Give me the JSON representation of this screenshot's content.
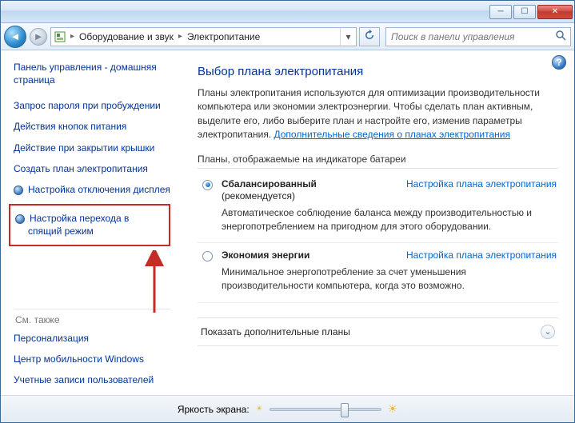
{
  "titlebar": {
    "min": "▁",
    "max": "▢",
    "close": "✕"
  },
  "nav": {
    "addr_seg1": "Оборудование и звук",
    "addr_seg2": "Электропитание",
    "search_placeholder": "Поиск в панели управления"
  },
  "sidebar": {
    "home": "Панель управления - домашняя страница",
    "links": [
      "Запрос пароля при пробуждении",
      "Действия кнопок питания",
      "Действие при закрытии крышки",
      "Создать план электропитания",
      "Настройка отключения дисплея",
      "Настройка перехода в спящий режим"
    ],
    "see_also_label": "См. также",
    "see_also": [
      "Персонализация",
      "Центр мобильности Windows",
      "Учетные записи пользователей"
    ]
  },
  "main": {
    "title": "Выбор плана электропитания",
    "intro": "Планы электропитания используются для оптимизации производительности компьютера или экономии электроэнергии. Чтобы сделать план активным, выделите его, либо выберите план и настройте его, изменив параметры электропитания. ",
    "intro_link": "Дополнительные сведения о планах электропитания",
    "section_head": "Планы, отображаемые на индикаторе батареи",
    "config_link": "Настройка плана электропитания",
    "plans": [
      {
        "name": "Сбалансированный",
        "rec": "(рекомендуется)",
        "desc": "Автоматическое соблюдение баланса между производительностью и энергопотреблением на пригодном для этого оборудовании.",
        "checked": true
      },
      {
        "name": "Экономия энергии",
        "rec": "",
        "desc": "Минимальное энергопотребление за счет уменьшения производительности компьютера, когда это возможно.",
        "checked": false
      }
    ],
    "expand": "Показать дополнительные планы"
  },
  "footer": {
    "label": "Яркость экрана:",
    "slider_pos_pct": 72
  }
}
